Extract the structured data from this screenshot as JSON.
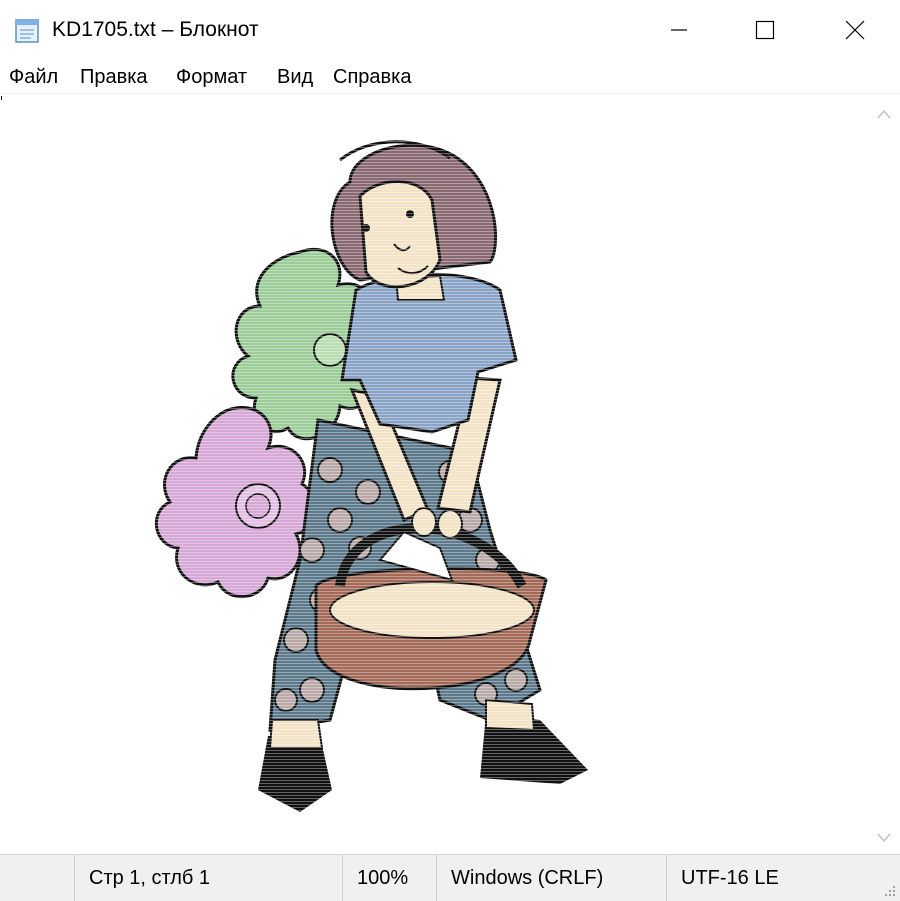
{
  "window": {
    "title": "KD1705.txt – Блокнот",
    "icon": "notepad-icon"
  },
  "menu": {
    "items": [
      "Файл",
      "Правка",
      "Формат",
      "Вид",
      "Справка"
    ]
  },
  "document": {
    "image_subject": "girl-with-basket-and-flowers-illustration"
  },
  "status": {
    "position": "Стр 1, стлб 1",
    "zoom": "100%",
    "line_endings": "Windows (CRLF)",
    "encoding": "UTF-16 LE"
  },
  "colors": {
    "shirt": "#8aa4c8",
    "hair": "#8a6a72",
    "skin": "#f3e3c6",
    "green_flower": "#9ccc98",
    "purple_flower": "#d6a8d6",
    "pants": "#5d7a8c",
    "basket": "#a46a58",
    "shoes": "#111111",
    "statusbar_bg": "#f0f0f0"
  }
}
